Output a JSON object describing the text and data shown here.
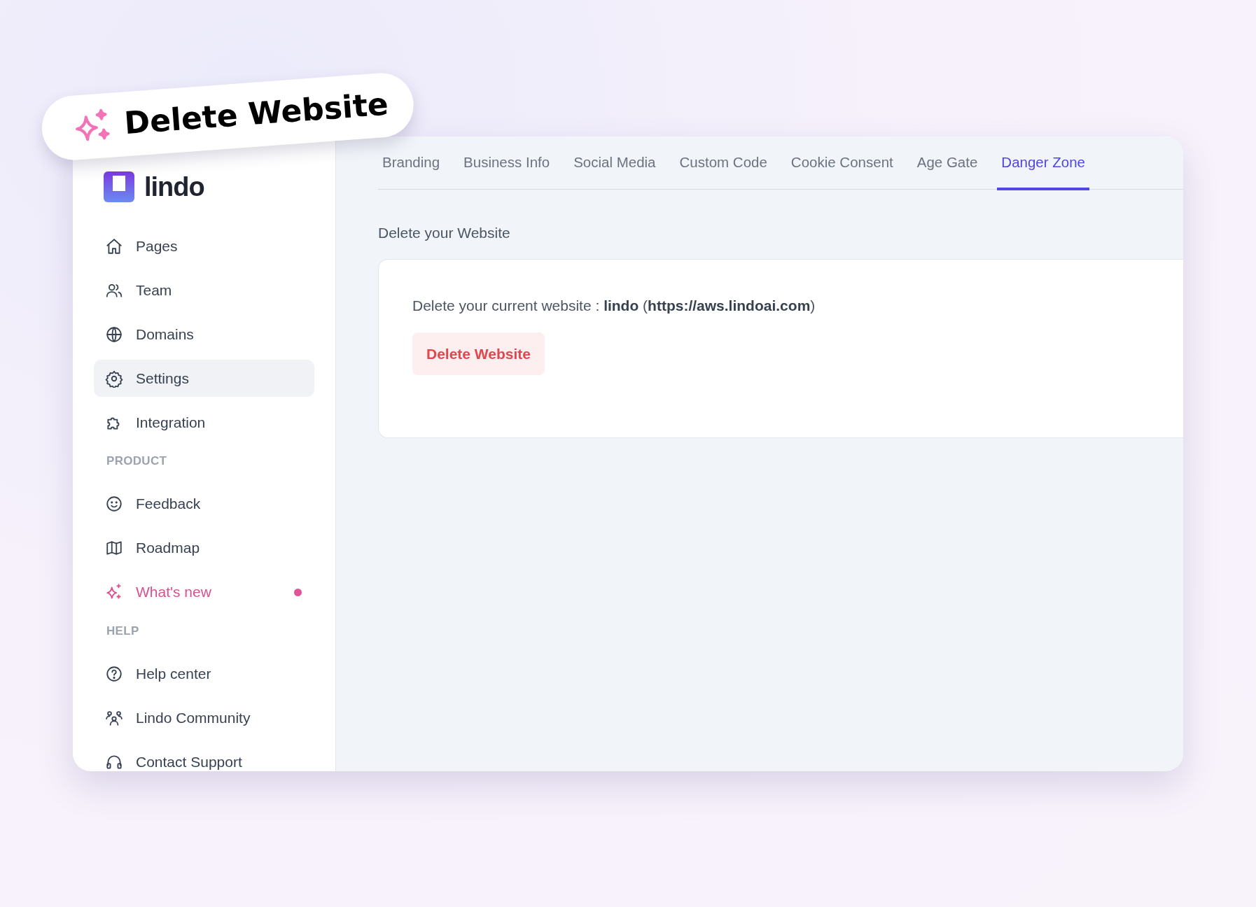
{
  "badge": {
    "title": "Delete Website"
  },
  "brand": {
    "name": "lindo"
  },
  "sidebar": {
    "items": [
      {
        "kind": "item",
        "label": "Pages",
        "selected": false,
        "new": false
      },
      {
        "kind": "item",
        "label": "Team",
        "selected": false,
        "new": false
      },
      {
        "kind": "item",
        "label": "Domains",
        "selected": false,
        "new": false
      },
      {
        "kind": "item",
        "label": "Settings",
        "selected": true,
        "new": false
      },
      {
        "kind": "item",
        "label": "Integration",
        "selected": false,
        "new": false
      },
      {
        "kind": "header",
        "label": "PRODUCT"
      },
      {
        "kind": "item",
        "label": "Feedback",
        "selected": false,
        "new": false
      },
      {
        "kind": "item",
        "label": "Roadmap",
        "selected": false,
        "new": false
      },
      {
        "kind": "item",
        "label": "What's new",
        "selected": false,
        "new": true
      },
      {
        "kind": "header",
        "label": "HELP"
      },
      {
        "kind": "item",
        "label": "Help center",
        "selected": false,
        "new": false
      },
      {
        "kind": "item",
        "label": "Lindo Community",
        "selected": false,
        "new": false
      },
      {
        "kind": "item",
        "label": "Contact Support",
        "selected": false,
        "new": false
      }
    ]
  },
  "tabs": [
    {
      "label": "Branding",
      "selected": false
    },
    {
      "label": "Business Info",
      "selected": false
    },
    {
      "label": "Social Media",
      "selected": false
    },
    {
      "label": "Custom Code",
      "selected": false
    },
    {
      "label": "Cookie Consent",
      "selected": false
    },
    {
      "label": "Age Gate",
      "selected": false
    },
    {
      "label": "Danger Zone",
      "selected": true
    }
  ],
  "section": {
    "title": "Delete your Website"
  },
  "card": {
    "text": "Delete your current website : **lindo** (**https://aws.lindoai.com**)",
    "button": "Delete Website"
  }
}
